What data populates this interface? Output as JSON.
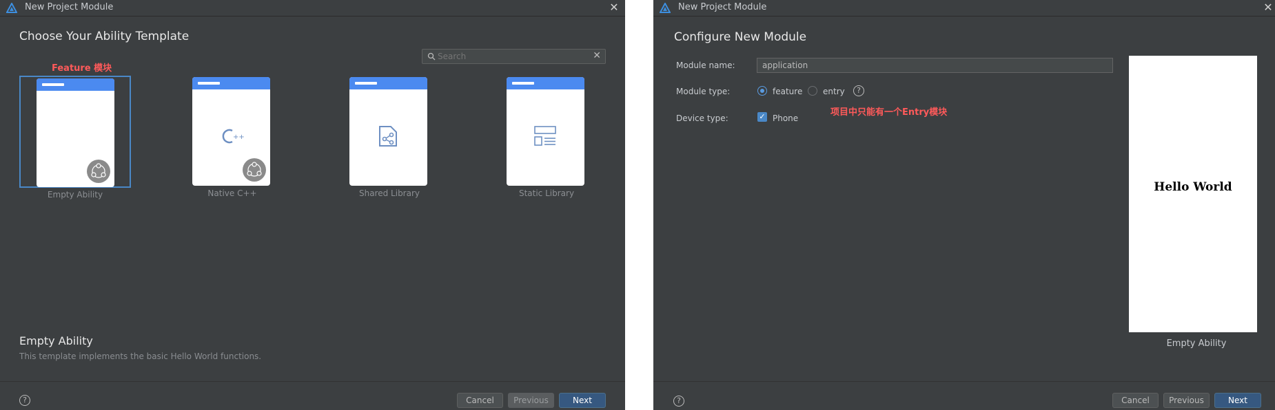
{
  "colors": {
    "dialog_bg": "#3c3f41",
    "accent": "#4a88c7",
    "primary_button": "#365880",
    "card_header": "#4b8af0",
    "annotation": "#ff5a5a"
  },
  "left": {
    "window_title": "New Project Module",
    "heading": "Choose Your Ability Template",
    "search": {
      "placeholder": "Search",
      "icon": "search-icon"
    },
    "annotation": "Feature 模块",
    "templates": [
      {
        "label": "Empty Ability",
        "selected": true,
        "icon": "module-badge-icon"
      },
      {
        "label": "Native C++",
        "selected": false,
        "icon": "cpp-icon"
      },
      {
        "label": "Shared Library",
        "selected": false,
        "icon": "shared-library-icon"
      },
      {
        "label": "Static Library",
        "selected": false,
        "icon": "static-library-icon"
      }
    ],
    "description": {
      "title": "Empty Ability",
      "text": "This template implements the basic Hello World functions."
    },
    "buttons": {
      "cancel": "Cancel",
      "previous": "Previous",
      "next": "Next"
    },
    "help": "?"
  },
  "right": {
    "window_title": "New Project Module",
    "heading": "Configure New Module",
    "fields": {
      "module_name_label": "Module name:",
      "module_name_value": "application",
      "module_type_label": "Module type:",
      "module_type_options": [
        "feature",
        "entry"
      ],
      "module_type_selected": "feature",
      "device_type_label": "Device type:",
      "device_type_option": "Phone",
      "device_type_checked": true
    },
    "annotation": "项目中只能有一个Entry模块",
    "preview": {
      "text": "Hello World",
      "caption": "Empty Ability"
    },
    "buttons": {
      "cancel": "Cancel",
      "previous": "Previous",
      "next": "Next"
    },
    "help": "?"
  }
}
